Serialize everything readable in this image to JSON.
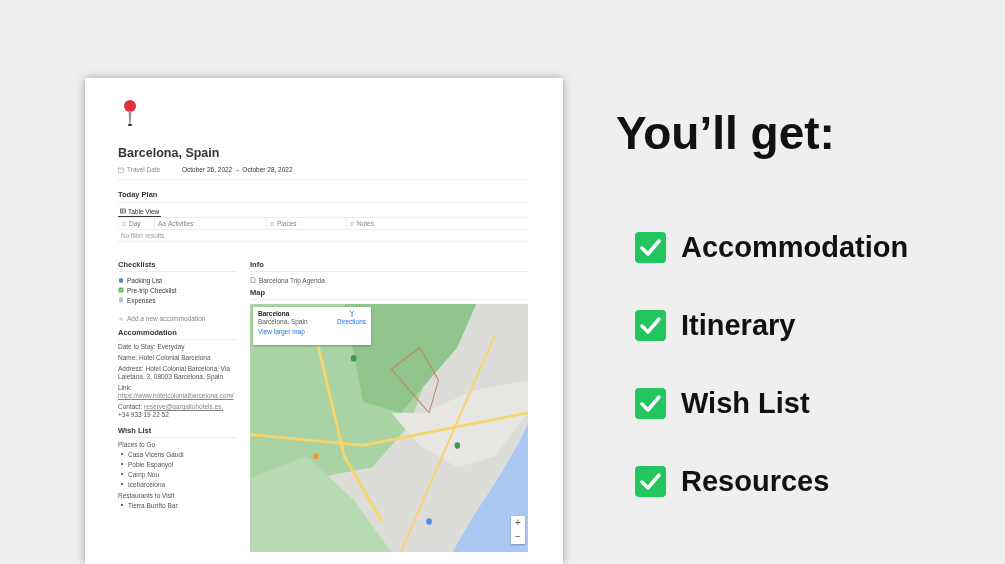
{
  "page": {
    "title": "Barcelona, Spain",
    "properties": [
      {
        "label": "Travel Date",
        "value": "October 26, 2022 → October 28, 2022"
      }
    ],
    "today_plan": {
      "heading": "Today Plan",
      "views": [
        {
          "label": "Table View",
          "selected": true
        }
      ],
      "columns": [
        {
          "label": "Day",
          "kind": "text"
        },
        {
          "label": "Activities",
          "kind": "title",
          "icon_text": "Aa"
        },
        {
          "label": "Places",
          "kind": "text"
        },
        {
          "label": "Notes",
          "kind": "text"
        }
      ],
      "empty_text": "No filter results"
    },
    "checklists": {
      "heading": "Checklists",
      "items": [
        {
          "label": "Packing List",
          "kind": "bag"
        },
        {
          "label": "Pre-trip Checklist",
          "kind": "check"
        },
        {
          "label": "Expenses",
          "kind": "note"
        }
      ]
    },
    "add_accommodation": "Add a new accommodation",
    "accommodation": {
      "heading": "Accommodation",
      "lines": [
        {
          "text": "Date to Stay: Everyday"
        },
        {
          "text": "Name: Hotel Colonial Barcelona"
        },
        {
          "text": "Address: Hotel Colonial Barcelona, Via Laietana, 3, 08003 Barcelona, Spain"
        },
        {
          "text": "Link:",
          "link": "https://www.hotelcolonialbarcelona.com/"
        },
        {
          "text": "Contact:",
          "link": "reserve@gargallohotels.es,",
          "after": "+34 933 19 22 52"
        }
      ]
    },
    "wish_list": {
      "heading": "Wish List",
      "groups": [
        {
          "heading": "Places to Go",
          "items": [
            "Casa Vicens Gaudí",
            "Poble Espanyol",
            "Camp Nou",
            "Icebarcelona"
          ]
        },
        {
          "heading": "Restaurants to Visit",
          "items": [
            "Tierra Burrito Bar"
          ]
        }
      ]
    },
    "info": {
      "heading": "Info",
      "items": [
        {
          "label": "Barcelona Trip Agenda"
        }
      ]
    },
    "map": {
      "heading": "Map",
      "place": "Barcelona",
      "address": "Barcelona, Spain",
      "directions": "Directions",
      "larger_link": "View larger map",
      "zoom_in": "+",
      "zoom_out": "−"
    }
  },
  "promo": {
    "headline": "You’ll get:",
    "features": [
      {
        "label": "Accommodation",
        "checked": true
      },
      {
        "label": "Itinerary",
        "checked": true
      },
      {
        "label": "Wish List",
        "checked": true
      },
      {
        "label": "Resources",
        "checked": true
      }
    ]
  }
}
